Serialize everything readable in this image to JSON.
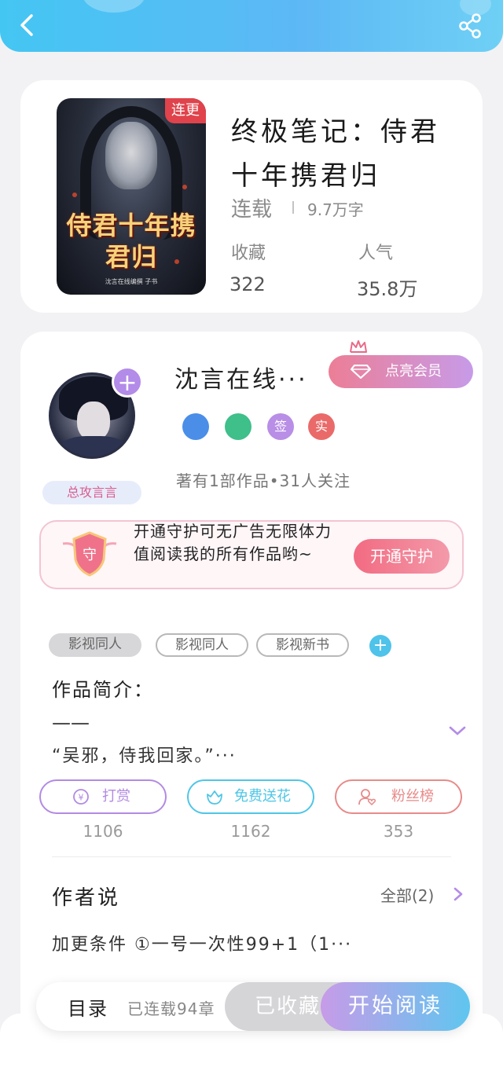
{
  "header": {
    "back_icon": "chevron-left-icon",
    "share_icon": "share-icon"
  },
  "book": {
    "cover_badge": "连更",
    "cover_title": "侍君十年携君归",
    "cover_author": "沈言在线编撰 子书",
    "title": "终极笔记：侍君十年携君归",
    "status": "连载",
    "word_count": "9.7万字",
    "favorites_label": "收藏",
    "favorites_value": "322",
    "popularity_label": "人气",
    "popularity_value": "35.8万"
  },
  "author": {
    "name": "沈言在线···",
    "vip_button": "点亮会员",
    "tag": "总攻言言",
    "medals": [
      {
        "text": "",
        "color": "#4a8ee8"
      },
      {
        "text": "",
        "color": "#3fbf8a"
      },
      {
        "text": "签",
        "color": "#b88ee6"
      },
      {
        "text": "实",
        "color": "#ea6a6a"
      }
    ],
    "stats": "著有1部作品•31人关注"
  },
  "guard": {
    "icon_text": "守",
    "text": "开通守护可无广告无限体力值阅读我的所有作品哟~",
    "button": "开通守护"
  },
  "tags": [
    "影视同人",
    "影视同人",
    "影视新书"
  ],
  "intro": {
    "label": "作品简介：",
    "dash": "——",
    "text": "“吴邪，侍我回家。”···"
  },
  "actions": [
    {
      "label": "打赏",
      "count": "1106",
      "color": "#b28ae3"
    },
    {
      "label": "免费送花",
      "count": "1162",
      "color": "#4fc6e6"
    },
    {
      "label": "粉丝榜",
      "count": "353",
      "color": "#e88a8a"
    }
  ],
  "author_says": {
    "label": "作者说",
    "all": "全部(2)",
    "text": "加更条件 ①一号一次性99+1（1···"
  },
  "bottom": {
    "catalog": "目录",
    "serial": "已连载94章",
    "collected": "已收藏",
    "start": "开始阅读"
  },
  "colors": {
    "accent_blue": "#4fc3ea",
    "accent_purple": "#b38be8",
    "accent_pink": "#ec7e96"
  }
}
